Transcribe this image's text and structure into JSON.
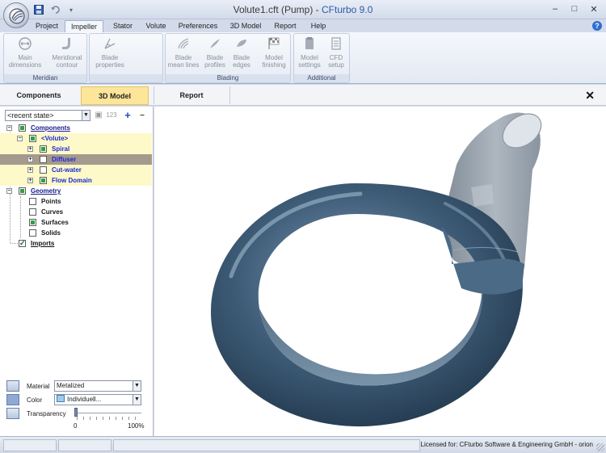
{
  "window": {
    "title_doc": "Volute1.cft (Pump)",
    "title_sep": " - ",
    "title_app": "CFturbo 9.0",
    "controls": [
      "–",
      "□",
      "✕"
    ]
  },
  "quick_access": {
    "save_icon": "save-icon",
    "undo_icon": "undo-icon",
    "more_icon": "dropdown-icon"
  },
  "ribbon": {
    "tabs": [
      "Project",
      "Impeller",
      "Stator",
      "Volute",
      "Preferences",
      "3D Model",
      "Report",
      "Help"
    ],
    "active_tab": "Impeller",
    "groups": [
      {
        "label": "Meridian",
        "buttons": [
          [
            "Main",
            "dimensions"
          ],
          [
            "Meridional",
            "contour"
          ]
        ]
      },
      {
        "label": "",
        "buttons": [
          [
            "Blade",
            "properties"
          ]
        ]
      },
      {
        "label": "Blading",
        "buttons": [
          [
            "Blade",
            "mean lines"
          ],
          [
            "Blade",
            "profiles"
          ],
          [
            "Blade",
            "edges"
          ],
          [
            "Model",
            "finishing"
          ]
        ]
      },
      {
        "label": "Additional",
        "buttons": [
          [
            "Model",
            "settings"
          ],
          [
            "CFD",
            "setup"
          ]
        ]
      }
    ]
  },
  "view_tabs": {
    "items": [
      "Components",
      "3D Model",
      "Report"
    ],
    "active": "3D Model",
    "close": "✕"
  },
  "state": {
    "value": "<recent state>",
    "buttons": [
      "▼",
      "▣",
      "123",
      "+",
      "–"
    ]
  },
  "tree": {
    "components": "Components",
    "volute": "<Volute>",
    "spiral": "Spiral",
    "diffuser": "Diffuser",
    "cutwater": "Cut-water",
    "flow_domain": "Flow Domain",
    "geometry": "Geometry",
    "points": "Points",
    "curves": "Curves",
    "surfaces": "Surfaces",
    "solids": "Solids",
    "imports": "Imports"
  },
  "props": {
    "material_label": "Material",
    "material_value": "Metalized",
    "color_label": "Color",
    "color_value": "Individuell...",
    "color_swatch": "#9ecbf0",
    "transparency_label": "Transparency",
    "transparency_min": "0",
    "transparency_max": "100%",
    "transparency_value": 0
  },
  "model_colors": {
    "body": "#3f5d78",
    "highlight": "#8fb0c9",
    "outlet": "#9aa4ae"
  },
  "status": {
    "license": "Licensed for: CFturbo Software & Engineering GmbH - orion"
  }
}
